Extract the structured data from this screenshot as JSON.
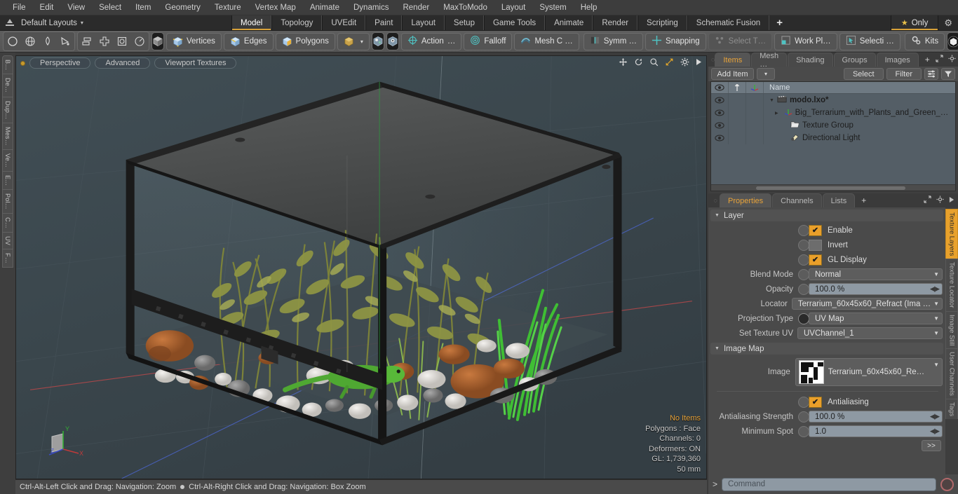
{
  "menubar": {
    "items": [
      "File",
      "Edit",
      "View",
      "Select",
      "Item",
      "Geometry",
      "Texture",
      "Vertex Map",
      "Animate",
      "Dynamics",
      "Render",
      "MaxToModo",
      "Layout",
      "System",
      "Help"
    ]
  },
  "layoutbar": {
    "layout_label": "Default Layouts",
    "layout_caret": "▾",
    "tabs": [
      "Model",
      "Topology",
      "UVEdit",
      "Paint",
      "Layout",
      "Setup",
      "Game Tools",
      "Animate",
      "Render",
      "Scripting",
      "Schematic Fusion"
    ],
    "active_tab": "Model",
    "add_tab": "+",
    "only_label": "Only",
    "star": "★",
    "gear": "⚙",
    "accent": "#d9a23a"
  },
  "toolbar": {
    "shape_icons": [
      "circle-icon",
      "globe-icon",
      "pen-icon",
      "curve-icon"
    ],
    "arrange_icons": [
      "align-icon",
      "center-icon",
      "frame-icon",
      "clock-icon"
    ],
    "element_cube": "cube-icon",
    "modes": [
      "Vertices",
      "Edges",
      "Polygons"
    ],
    "mode_dropdown_caret": "▾",
    "action_label": "Action",
    "action_ellipsis": "…",
    "falloff_label": "Falloff",
    "mesh_label": "Mesh C …",
    "symmetry_label": "Symm …",
    "snapping_label": "Snapping",
    "select_through_label": "Select T…",
    "work_plane_label": "Work Pl…",
    "selection_label": "Selecti …",
    "kits_label": "Kits"
  },
  "left_tabs": [
    "B…",
    "De…",
    "Dup…",
    "Mes…",
    "Ve…",
    "E…",
    "Pol…",
    "C…",
    "UV",
    "F…"
  ],
  "viewport": {
    "dot": "active-indicator",
    "pills": [
      "Perspective",
      "Advanced",
      "Viewport Textures"
    ],
    "tools": [
      "move-icon",
      "rotate-icon",
      "magnifier-icon",
      "fit-icon",
      "gear-icon",
      "play-icon"
    ],
    "status": {
      "no_items": "No Items",
      "polygons": "Polygons : Face",
      "channels": "Channels: 0",
      "deformers": "Deformers: ON",
      "gl": "GL: 1,739,360",
      "grid": "50 mm"
    },
    "axis_gizmo": {
      "x": "X",
      "y": "Y",
      "z": "Z"
    }
  },
  "statusbar": {
    "left": "Ctrl-Alt-Left Click and Drag: Navigation: Zoom",
    "right": "Ctrl-Alt-Right Click and Drag: Navigation: Box Zoom"
  },
  "right_panel": {
    "top_tabs": [
      "Items",
      "Mesh …",
      "Shading",
      "Groups",
      "Images"
    ],
    "top_active": "Items",
    "top_add": "+",
    "top_icons": [
      "expand-icon",
      "gear-icon",
      "play-icon"
    ],
    "items_toolbar": {
      "add_item": "Add Item",
      "dropdown_caret": "▾",
      "select": "Select",
      "filter": "Filter",
      "list_icon": "list-icon",
      "funnel_icon": "funnel-icon"
    },
    "tree": {
      "columns": [
        "eye-icon",
        "pin-icon",
        "axis-icon",
        "Name"
      ],
      "name_header": "Name",
      "rows": [
        {
          "name": "modo.lxo*",
          "icon": "scene-icon",
          "indent": 0,
          "bold": true,
          "expander": "▼"
        },
        {
          "name": "Big_Terrarium_with_Plants_and_Green_…",
          "icon": "mesh-axis-icon",
          "indent": 1,
          "bold": false,
          "expander": "▶"
        },
        {
          "name": "Texture Group",
          "icon": "folder-icon",
          "indent": 1,
          "bold": false,
          "expander": ""
        },
        {
          "name": "Directional Light",
          "icon": "light-icon",
          "indent": 1,
          "bold": false,
          "expander": ""
        }
      ]
    },
    "props_tabs": [
      "Properties",
      "Channels",
      "Lists"
    ],
    "props_active": "Properties",
    "props_add": "+",
    "props_icons": [
      "expand-icon",
      "gear-icon",
      "play-icon"
    ],
    "layer_section": {
      "title": "Layer",
      "toggles": [
        {
          "label": "Enable",
          "checked": true
        },
        {
          "label": "Invert",
          "checked": false
        },
        {
          "label": "GL Display",
          "checked": true
        }
      ],
      "fields": [
        {
          "label": "Blend Mode",
          "value": "Normal",
          "type": "dropdown",
          "knob": "ring"
        },
        {
          "label": "Opacity",
          "value": "100.0 %",
          "type": "slider",
          "knob": "ring"
        },
        {
          "label": "Locator",
          "value": "Terrarium_60x45x60_Refract (Ima …",
          "type": "dropdown",
          "knob": "none"
        },
        {
          "label": "Projection Type",
          "value": "UV Map",
          "type": "dropdown",
          "knob": "filled"
        },
        {
          "label": "Set Texture UV",
          "value": "UVChannel_1",
          "type": "dropdown",
          "knob": "none"
        }
      ]
    },
    "image_map_section": {
      "title": "Image Map",
      "image_label": "Image",
      "image_value": "Terrarium_60x45x60_Refr …",
      "image_thumb": "checker-thumbnail",
      "antialiasing": {
        "label": "Antialiasing",
        "checked": true
      },
      "fields": [
        {
          "label": "Antialiasing Strength",
          "value": "100.0 %",
          "type": "slider"
        },
        {
          "label": "Minimum Spot",
          "value": "1.0",
          "type": "slider"
        }
      ],
      "more_button": ">>"
    },
    "side_tabs": [
      "Texture Layers",
      "Texture Locator",
      "Image Still",
      "User Channels",
      "Tags"
    ],
    "side_active": "Texture Layers"
  },
  "command_bar": {
    "prompt": ">",
    "placeholder": "Command",
    "record_icon": "record-icon"
  },
  "colors": {
    "accent_orange": "#e8a12c",
    "panel_bg": "#4a4a4a",
    "viewport_bg": "#3a4449",
    "tree_bg": "#545e66",
    "field_light": "#8e99a3"
  }
}
